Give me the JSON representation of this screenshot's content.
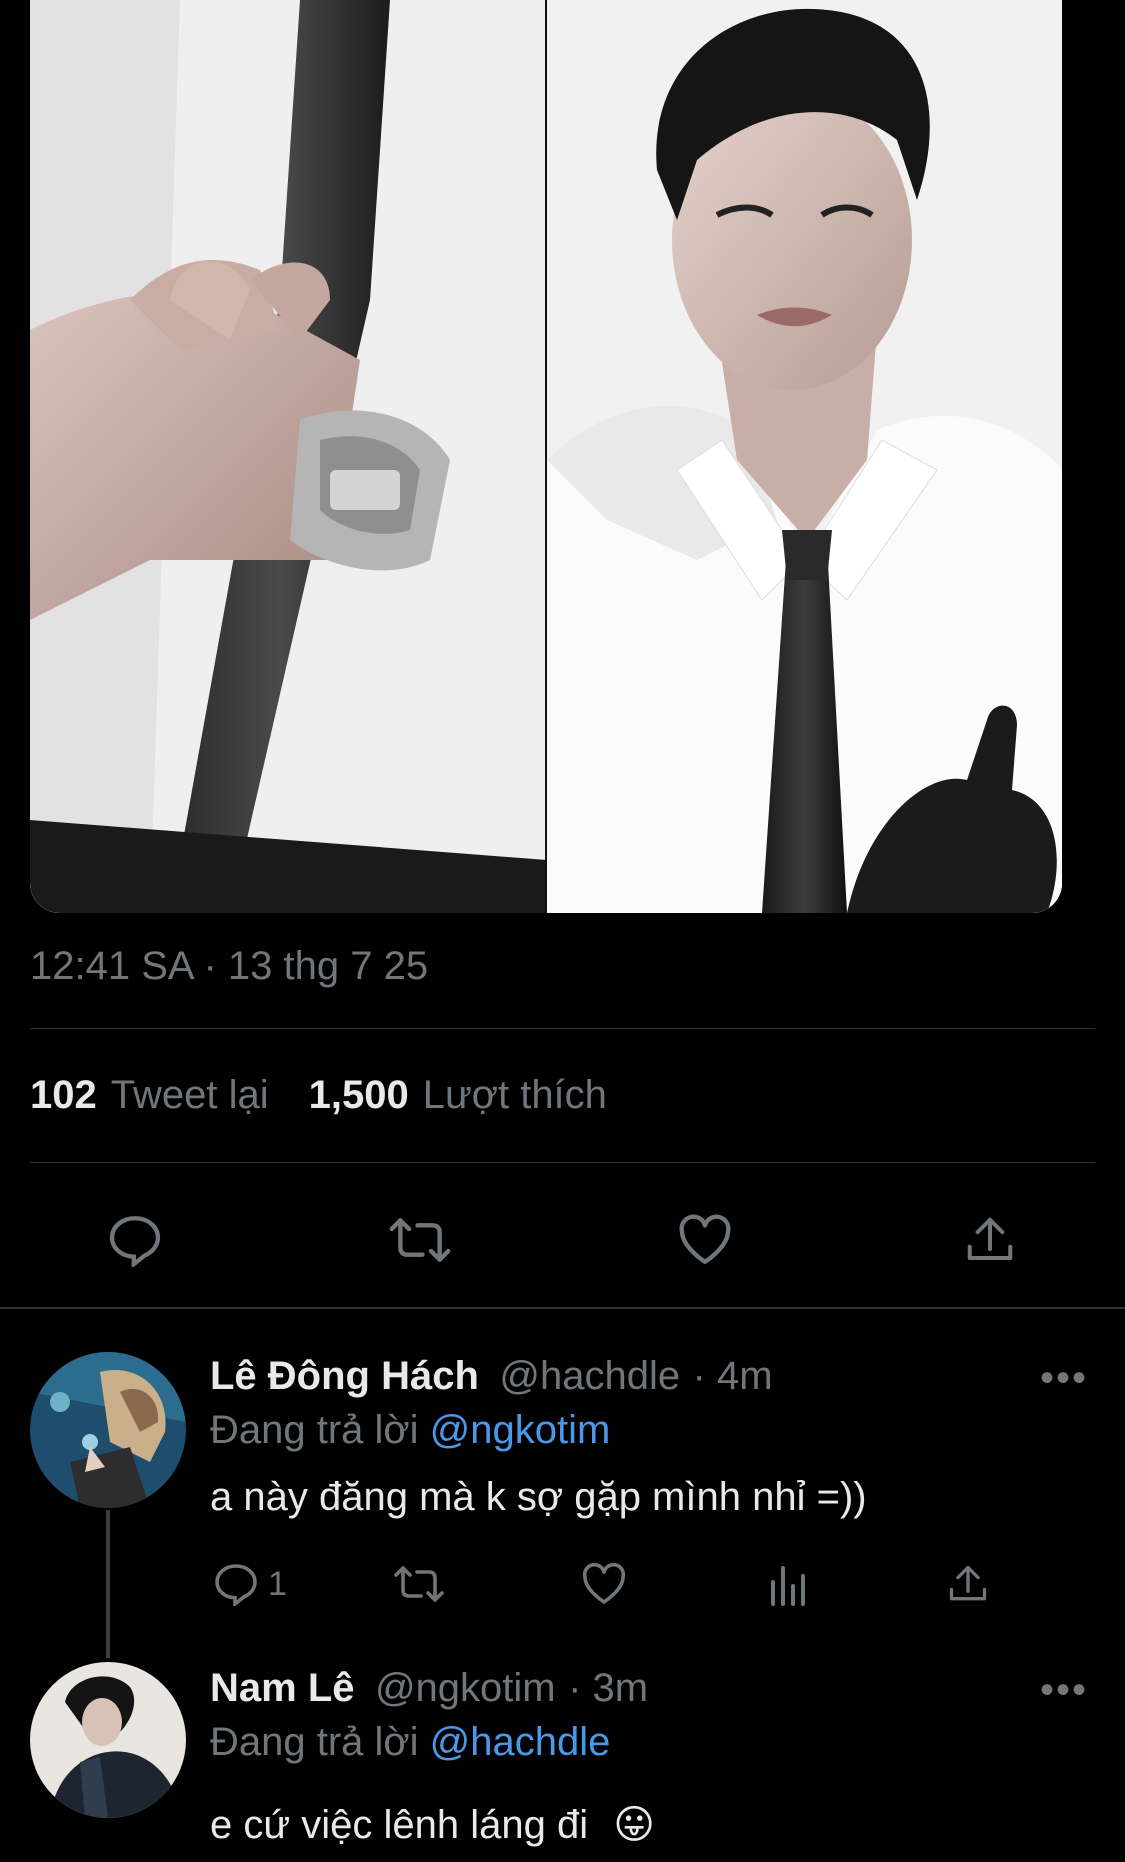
{
  "tweet": {
    "timestamp": "12:41 SA · 13 thg 7 25",
    "retweet_count": "102",
    "retweet_label": "Tweet lại",
    "like_count": "1,500",
    "like_label": "Lượt thích",
    "actions": [
      "reply-icon",
      "retweet-icon",
      "like-icon",
      "share-icon"
    ]
  },
  "replies": [
    {
      "name": "Lê Đông Hách",
      "handle": "@hachdle",
      "time": "· 4m",
      "replying_label": "Đang trả lời",
      "replying_to": "@ngkotim",
      "text": "a này đăng mà k sợ gặp mình nhỉ =))",
      "reply_count": "1",
      "more": "•••"
    },
    {
      "name": "Nam Lê",
      "handle": "@ngkotim",
      "time": "· 3m",
      "replying_label": "Đang trả lời",
      "replying_to": "@hachdle",
      "text": "e cứ việc lênh láng đi",
      "emoji": "😛",
      "more": "•••"
    }
  ],
  "colors": {
    "background": "#000000",
    "text": "#e7e9ea",
    "muted": "#71767b",
    "link": "#4a99e9",
    "divider": "#2f3336"
  }
}
